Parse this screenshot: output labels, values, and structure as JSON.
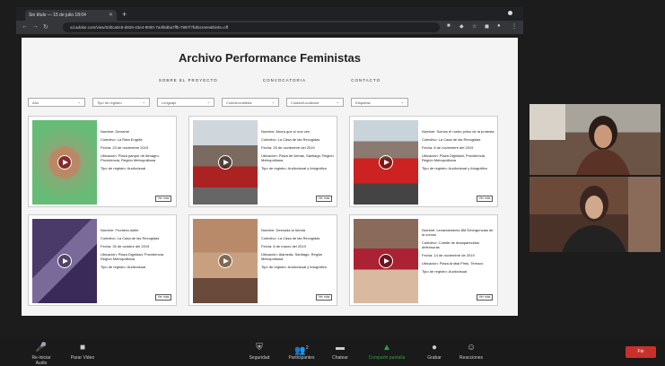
{
  "browser": {
    "tab_title": "Sin título — 15 de julio 18:04",
    "tab_close": "✕",
    "new_tab": "+",
    "url": "xd.adobe.com/view/2d0ca0c8-d826-43e4-9000-7a4f6dba7ffb-7887/?fullscreen&hints=off"
  },
  "site": {
    "title": "Archivo Performance Feministas",
    "nav": [
      "SOBRE EL PROYECTO",
      "CONVOCATORIA",
      "CONTACTO"
    ],
    "filters": [
      "Año",
      "Tipo de registro",
      "Lenguaje",
      "Colectivo/artista",
      "Ciudad/Localidad",
      "Etiquetas"
    ],
    "cards": [
      {
        "nombre": "Nombre: Derrame",
        "colectivo": "Colectivo: La Rata Engrifá",
        "fecha": "Fecha: 23 de noviembre 2019",
        "ubicacion": "Ubicación: Plaza parque de Almagro, Providencia, Región Metropolitana",
        "tipo": "Tipo de registro: Audiovisual",
        "btn": "Ver más"
      },
      {
        "nombre": "Nombre: Ahora que sí nos ven",
        "colectivo": "Colectivo: La Casa de las Recogidas",
        "fecha": "Fecha: 25 de noviembre del 2019",
        "ubicacion": "Ubicación: Plaza de Armas, Santiago, Región Metropolitana",
        "tipo": "Tipo de registro: Audiovisual y fotográfico",
        "btn": "Ver más"
      },
      {
        "nombre": "Nombre: Somos el rostro pulso de la protesta",
        "colectivo": "Colectivo: La Casa de las Recogidas",
        "fecha": "Fecha: 8 de noviembre del 2019",
        "ubicacion": "Ubicación: Plaza Dignidad, Providencia, Región Metropolitana",
        "tipo": "Tipo de registro: Audiovisual y fotográfico",
        "btn": "Ver más"
      },
      {
        "nombre": "Nombre: Frontera doble",
        "colectivo": "Colectivo: La Casa de las Recogidas",
        "fecha": "Fecha: 30 de octubre del 2019",
        "ubicacion": "Ubicación: Plaza Dignidad, Providencia, Región Metropolitana",
        "tipo": "Tipo de registro: Audiovisual",
        "btn": "Ver más"
      },
      {
        "nombre": "Nombre: Desnuda la herida",
        "colectivo": "Colectivo: La Casa de las Recogidas",
        "fecha": "Fecha: 8 de marzo del 2019",
        "ubicacion": "Ubicación: Alameda, Santiago, Región Metropolitana",
        "tipo": "Tipo de registro: Audiovisual y fotográfico",
        "btn": "Ver más"
      },
      {
        "nombre": "Nombre: Levantamiento 8M Emergencias de la común",
        "colectivo": "Colectivo: Comité de desaparecidos defensoras",
        "fecha": "Fecha: 14 de noviembre de 2019",
        "ubicacion": "Ubicación: Plaza Aníbal Pinto, Temuco",
        "tipo": "Tipo de registro: Audiovisual",
        "btn": "Ver más"
      }
    ]
  },
  "zoom_toolbar": {
    "items": [
      {
        "label": "Re-iniciar Audio",
        "icon": "mic-muted-icon",
        "glyph": "🎤"
      },
      {
        "label": "Parar Video",
        "icon": "camera-icon",
        "glyph": "■"
      },
      {
        "label": "Seguridad",
        "icon": "shield-icon",
        "glyph": "⛨"
      },
      {
        "label": "Participantes",
        "icon": "participants-icon",
        "glyph": "👥"
      },
      {
        "label": "Chatear",
        "icon": "chat-icon",
        "glyph": "▬"
      },
      {
        "label": "Compartir pantalla",
        "icon": "share-screen-icon",
        "glyph": "▲"
      },
      {
        "label": "Grabar",
        "icon": "record-icon",
        "glyph": "●"
      },
      {
        "label": "Reacciones",
        "icon": "reactions-icon",
        "glyph": "☺"
      }
    ],
    "participants_count": "2",
    "end_label": "Fin",
    "colors": {
      "share_green": "#2ea043",
      "end_red": "#c9302c"
    }
  }
}
